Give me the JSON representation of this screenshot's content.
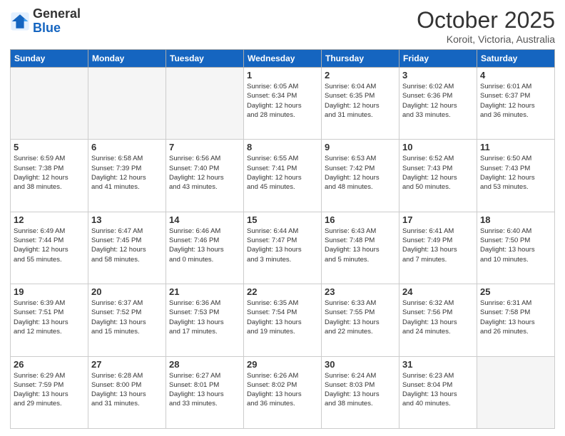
{
  "logo": {
    "line1": "General",
    "line2": "Blue"
  },
  "title": "October 2025",
  "subtitle": "Koroit, Victoria, Australia",
  "days_of_week": [
    "Sunday",
    "Monday",
    "Tuesday",
    "Wednesday",
    "Thursday",
    "Friday",
    "Saturday"
  ],
  "weeks": [
    [
      {
        "day": "",
        "info": ""
      },
      {
        "day": "",
        "info": ""
      },
      {
        "day": "",
        "info": ""
      },
      {
        "day": "1",
        "info": "Sunrise: 6:05 AM\nSunset: 6:34 PM\nDaylight: 12 hours\nand 28 minutes."
      },
      {
        "day": "2",
        "info": "Sunrise: 6:04 AM\nSunset: 6:35 PM\nDaylight: 12 hours\nand 31 minutes."
      },
      {
        "day": "3",
        "info": "Sunrise: 6:02 AM\nSunset: 6:36 PM\nDaylight: 12 hours\nand 33 minutes."
      },
      {
        "day": "4",
        "info": "Sunrise: 6:01 AM\nSunset: 6:37 PM\nDaylight: 12 hours\nand 36 minutes."
      }
    ],
    [
      {
        "day": "5",
        "info": "Sunrise: 6:59 AM\nSunset: 7:38 PM\nDaylight: 12 hours\nand 38 minutes."
      },
      {
        "day": "6",
        "info": "Sunrise: 6:58 AM\nSunset: 7:39 PM\nDaylight: 12 hours\nand 41 minutes."
      },
      {
        "day": "7",
        "info": "Sunrise: 6:56 AM\nSunset: 7:40 PM\nDaylight: 12 hours\nand 43 minutes."
      },
      {
        "day": "8",
        "info": "Sunrise: 6:55 AM\nSunset: 7:41 PM\nDaylight: 12 hours\nand 45 minutes."
      },
      {
        "day": "9",
        "info": "Sunrise: 6:53 AM\nSunset: 7:42 PM\nDaylight: 12 hours\nand 48 minutes."
      },
      {
        "day": "10",
        "info": "Sunrise: 6:52 AM\nSunset: 7:43 PM\nDaylight: 12 hours\nand 50 minutes."
      },
      {
        "day": "11",
        "info": "Sunrise: 6:50 AM\nSunset: 7:43 PM\nDaylight: 12 hours\nand 53 minutes."
      }
    ],
    [
      {
        "day": "12",
        "info": "Sunrise: 6:49 AM\nSunset: 7:44 PM\nDaylight: 12 hours\nand 55 minutes."
      },
      {
        "day": "13",
        "info": "Sunrise: 6:47 AM\nSunset: 7:45 PM\nDaylight: 12 hours\nand 58 minutes."
      },
      {
        "day": "14",
        "info": "Sunrise: 6:46 AM\nSunset: 7:46 PM\nDaylight: 13 hours\nand 0 minutes."
      },
      {
        "day": "15",
        "info": "Sunrise: 6:44 AM\nSunset: 7:47 PM\nDaylight: 13 hours\nand 3 minutes."
      },
      {
        "day": "16",
        "info": "Sunrise: 6:43 AM\nSunset: 7:48 PM\nDaylight: 13 hours\nand 5 minutes."
      },
      {
        "day": "17",
        "info": "Sunrise: 6:41 AM\nSunset: 7:49 PM\nDaylight: 13 hours\nand 7 minutes."
      },
      {
        "day": "18",
        "info": "Sunrise: 6:40 AM\nSunset: 7:50 PM\nDaylight: 13 hours\nand 10 minutes."
      }
    ],
    [
      {
        "day": "19",
        "info": "Sunrise: 6:39 AM\nSunset: 7:51 PM\nDaylight: 13 hours\nand 12 minutes."
      },
      {
        "day": "20",
        "info": "Sunrise: 6:37 AM\nSunset: 7:52 PM\nDaylight: 13 hours\nand 15 minutes."
      },
      {
        "day": "21",
        "info": "Sunrise: 6:36 AM\nSunset: 7:53 PM\nDaylight: 13 hours\nand 17 minutes."
      },
      {
        "day": "22",
        "info": "Sunrise: 6:35 AM\nSunset: 7:54 PM\nDaylight: 13 hours\nand 19 minutes."
      },
      {
        "day": "23",
        "info": "Sunrise: 6:33 AM\nSunset: 7:55 PM\nDaylight: 13 hours\nand 22 minutes."
      },
      {
        "day": "24",
        "info": "Sunrise: 6:32 AM\nSunset: 7:56 PM\nDaylight: 13 hours\nand 24 minutes."
      },
      {
        "day": "25",
        "info": "Sunrise: 6:31 AM\nSunset: 7:58 PM\nDaylight: 13 hours\nand 26 minutes."
      }
    ],
    [
      {
        "day": "26",
        "info": "Sunrise: 6:29 AM\nSunset: 7:59 PM\nDaylight: 13 hours\nand 29 minutes."
      },
      {
        "day": "27",
        "info": "Sunrise: 6:28 AM\nSunset: 8:00 PM\nDaylight: 13 hours\nand 31 minutes."
      },
      {
        "day": "28",
        "info": "Sunrise: 6:27 AM\nSunset: 8:01 PM\nDaylight: 13 hours\nand 33 minutes."
      },
      {
        "day": "29",
        "info": "Sunrise: 6:26 AM\nSunset: 8:02 PM\nDaylight: 13 hours\nand 36 minutes."
      },
      {
        "day": "30",
        "info": "Sunrise: 6:24 AM\nSunset: 8:03 PM\nDaylight: 13 hours\nand 38 minutes."
      },
      {
        "day": "31",
        "info": "Sunrise: 6:23 AM\nSunset: 8:04 PM\nDaylight: 13 hours\nand 40 minutes."
      },
      {
        "day": "",
        "info": ""
      }
    ]
  ]
}
